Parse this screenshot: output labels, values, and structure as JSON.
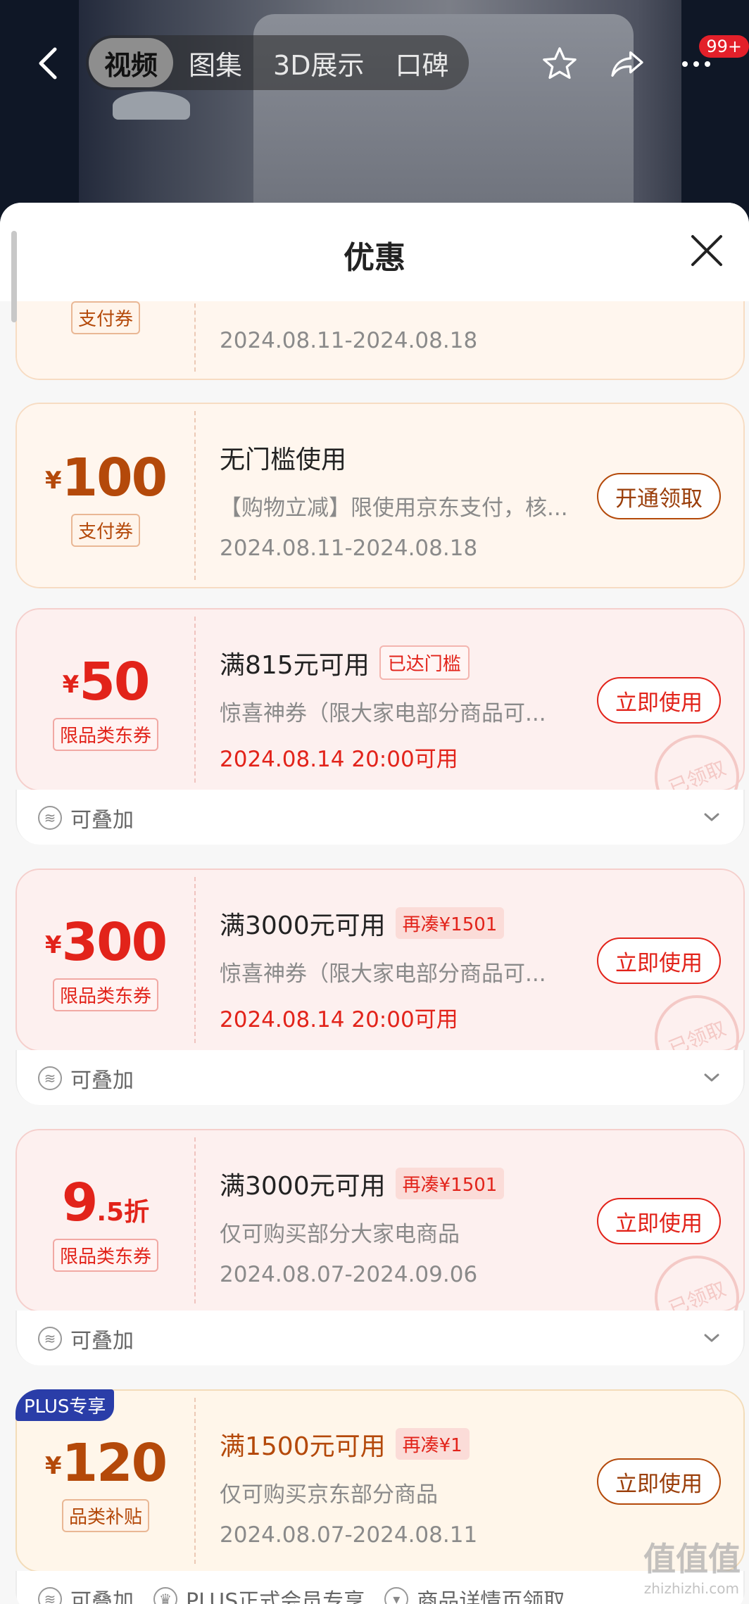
{
  "topbar": {
    "tabs": [
      "视频",
      "图集",
      "3D展示",
      "口碑"
    ],
    "active_tab": 0,
    "badge": "99+"
  },
  "sheet": {
    "title": "优惠"
  },
  "coupons": [
    {
      "style": "orange",
      "type_tag": "支付券",
      "date": "2024.08.11-2024.08.18"
    },
    {
      "style": "orange",
      "currency": "¥",
      "amount": "100",
      "type_tag": "支付券",
      "condition": "无门槛使用",
      "desc": "【购物立减】限使用京东支付，核...",
      "date": "2024.08.11-2024.08.18",
      "button": "开通领取"
    },
    {
      "style": "red",
      "currency": "¥",
      "amount": "50",
      "type_tag": "限品类东券",
      "condition": "满815元可用",
      "chip": "已达门槛",
      "desc": "惊喜神券（限大家电部分商品可...",
      "date": "2024.08.14 20:00可用",
      "button": "立即使用",
      "stamp": "已领取",
      "footer": "可叠加"
    },
    {
      "style": "red",
      "currency": "¥",
      "amount": "300",
      "type_tag": "限品类东券",
      "condition": "满3000元可用",
      "chip": "再凑¥1501",
      "desc": "惊喜神券（限大家电部分商品可...",
      "date": "2024.08.14 20:00可用",
      "button": "立即使用",
      "stamp": "已领取",
      "footer": "可叠加"
    },
    {
      "style": "red",
      "amount_int": "9",
      "amount_dec": ".5折",
      "type_tag": "限品类东券",
      "condition": "满3000元可用",
      "chip": "再凑¥1501",
      "desc": "仅可购买部分大家电商品",
      "date": "2024.08.07-2024.09.06",
      "button": "立即使用",
      "stamp": "已领取",
      "footer": "可叠加"
    },
    {
      "style": "plus",
      "plus_badge": "PLUS专享",
      "currency": "¥",
      "amount": "120",
      "type_tag": "品类补贴",
      "condition": "满1500元可用",
      "chip": "再凑¥1",
      "desc": "仅可购买京东部分商品",
      "date": "2024.08.07-2024.08.11",
      "button": "立即使用",
      "footer_items": [
        "可叠加",
        "PLUS正式会员专享",
        "商品详情页领取"
      ]
    }
  ],
  "watermark": {
    "main": "值值值",
    "sub": "zhizhizhi.com"
  }
}
